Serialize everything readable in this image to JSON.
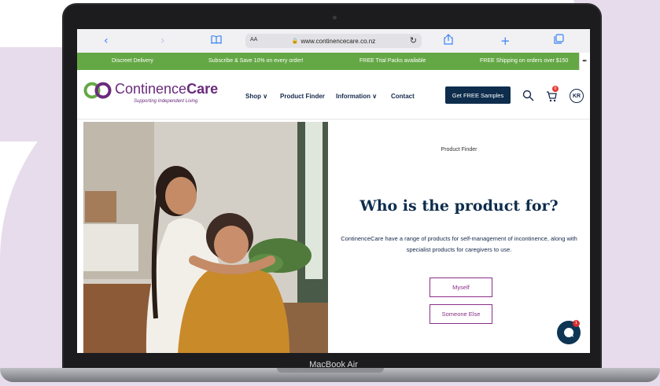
{
  "device": {
    "model": "MacBook Air"
  },
  "browser": {
    "url": "www.continencecare.co.nz",
    "aa_label": "AA",
    "icons": [
      "back-icon",
      "forward-icon",
      "bookmarks-icon",
      "lock-icon",
      "reload-icon",
      "share-icon",
      "new-tab-icon",
      "tabs-icon"
    ]
  },
  "promo_bar": {
    "background": "#64a845",
    "items": [
      "Discreet Delivery",
      "Subscribe & Save 10% on every order!",
      "FREE Trial Packs available",
      "FREE Shipping on orders over $150"
    ]
  },
  "header": {
    "logo_name_regular": "Continence",
    "logo_name_bold": "Care",
    "logo_tagline": "Supporting Independent Living",
    "nav": [
      {
        "label": "Shop",
        "dropdown": true
      },
      {
        "label": "Product Finder",
        "dropdown": false
      },
      {
        "label": "Information",
        "dropdown": true
      },
      {
        "label": "Contact",
        "dropdown": false
      }
    ],
    "cta": "Get FREE Samples",
    "cart_count": "0",
    "avatar_initials": "KR",
    "brand_color": "#6a2a7c",
    "navy": "#0e2d4d"
  },
  "hero": {
    "eyebrow": "Product Finder",
    "title": "Who is the product for?",
    "description": "ContinenceCare have a range of products for self-management of incontinence, along with specialist products for caregivers to use.",
    "options": [
      "Myself",
      "Someone Else"
    ],
    "accent": "#8a2f86"
  },
  "chat": {
    "badge": "1"
  }
}
